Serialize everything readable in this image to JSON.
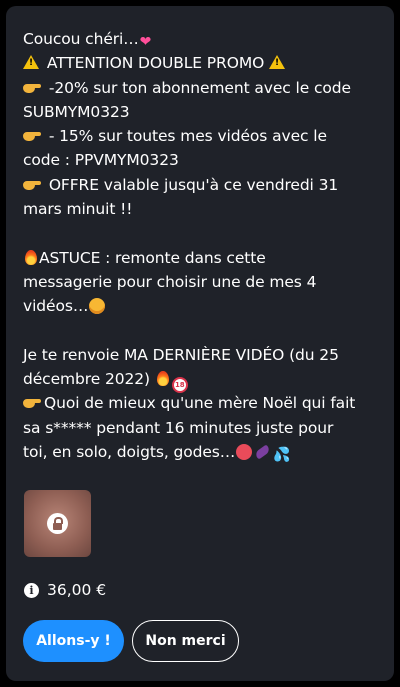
{
  "message": {
    "lines": [
      "Coucou chéri…",
      "ATTENTION DOUBLE PROMO",
      "-20% sur ton abonnement avec le code",
      "SUBMYM0323",
      "- 15% sur toutes mes vidéos avec le",
      "code : PPVMYM0323",
      "OFFRE valable jusqu'à ce vendredi 31",
      "mars minuit !!",
      "ASTUCE : remonte dans cette",
      "messagerie pour choisir une de mes 4",
      "vidéos…",
      "Je te renvoie MA DERNIÈRE VIDÉO (du 25",
      "décembre 2022)",
      "Quoi de mieux qu'une mère Noël qui fait",
      "sa s***** pendant 16 minutes juste pour",
      "toi, en solo, doigts, godes…"
    ],
    "no18_badge": "18"
  },
  "icons": {
    "hearts": "two-hearts-icon",
    "warning": "warning-icon",
    "pointing_hand": "pointing-right-hand-icon",
    "fire": "fire-icon",
    "star_eyes": "star-struck-face-icon",
    "no_under_18": "no-under-18-icon",
    "angry_face": "angry-face-icon",
    "eggplant": "eggplant-icon",
    "droplets": "sweat-droplets-icon",
    "lock": "lock-icon",
    "info": "info-icon"
  },
  "media": {
    "locked": true
  },
  "price": {
    "amount": "36,00 €"
  },
  "actions": {
    "primary_label": "Allons-y !",
    "secondary_label": "Non merci"
  },
  "colors": {
    "card_background": "#1f2229",
    "page_background": "#000000",
    "primary_button": "#1e90ff",
    "text": "#ffffff"
  }
}
